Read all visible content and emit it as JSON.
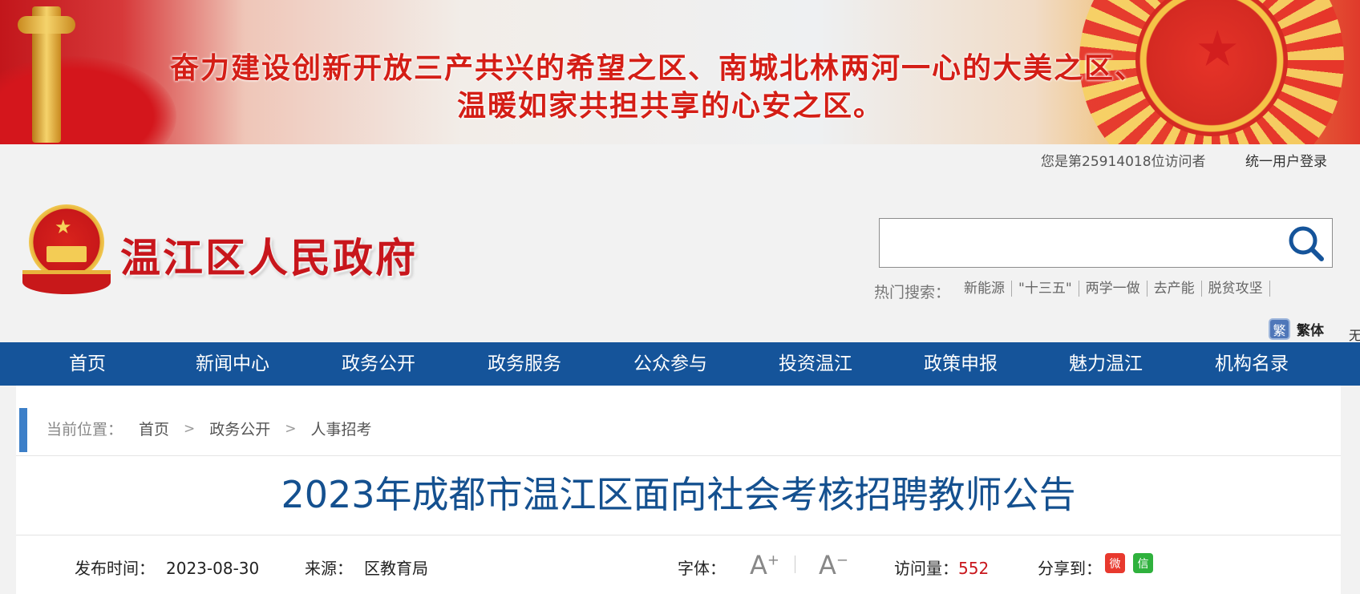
{
  "banner": {
    "slogan_line1": "奋力建设创新开放三产共兴的希望之区、南城北林两河一心的大美之区、",
    "slogan_line2": "温暖如家共担共享的心安之区。"
  },
  "topbar": {
    "visitor_text": "您是第25914018位访问者",
    "login": "统一用户登录"
  },
  "header": {
    "site_title": "温江区人民政府"
  },
  "search": {
    "placeholder": "",
    "hot_label": "热门搜索：",
    "hot_items": [
      "新能源",
      "\"十三五\"",
      "两学一做",
      "去产能",
      "脱贫攻坚"
    ]
  },
  "traditional": {
    "icon_char": "繁",
    "label": "繁体",
    "edge_text": "无"
  },
  "nav": {
    "items": [
      "首页",
      "新闻中心",
      "政务公开",
      "政务服务",
      "公众参与",
      "投资温江",
      "政策申报",
      "魅力温江",
      "机构名录"
    ]
  },
  "breadcrumb": {
    "label": "当前位置：",
    "items": [
      "首页",
      "政务公开",
      "人事招考"
    ],
    "separator": ">"
  },
  "article": {
    "title": "2023年成都市温江区面向社会考核招聘教师公告",
    "publish_label": "发布时间：",
    "publish_date": "2023-08-30",
    "source_label": "来源：",
    "source": "区教育局",
    "font_label": "字体：",
    "font_increase": "A",
    "font_increase_mark": "+",
    "font_decrease": "A",
    "font_decrease_mark": "−",
    "visits_label": "访问量：",
    "visits": "552",
    "share_label": "分享到："
  },
  "colors": {
    "nav_bg": "#15549a",
    "title_blue": "#14508f",
    "brand_red": "#c8161c"
  }
}
